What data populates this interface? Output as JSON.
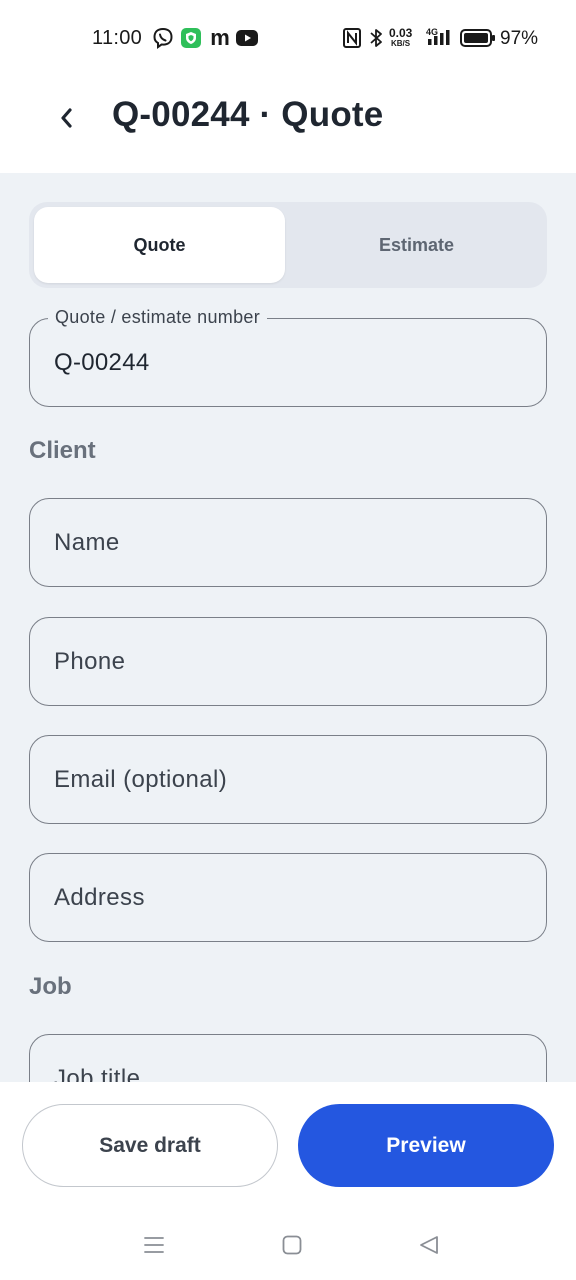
{
  "status_bar": {
    "time": "11:00",
    "net_speed_value": "0.03",
    "net_speed_unit": "KB/S",
    "network_type": "4G",
    "battery": "97%",
    "icons": [
      "viber-icon",
      "shield-app-icon",
      "m-app-icon",
      "youtube-icon",
      "nfc-icon",
      "bluetooth-icon",
      "signal-icon",
      "battery-icon"
    ]
  },
  "header": {
    "back_icon": "chevron-left-icon",
    "title": "Q-00244 · Quote"
  },
  "segmented": {
    "tabs": [
      {
        "label": "Quote",
        "selected": true
      },
      {
        "label": "Estimate",
        "selected": false
      }
    ]
  },
  "quote_number": {
    "label": "Quote / estimate number",
    "value": "Q-00244"
  },
  "client": {
    "section_label": "Client",
    "fields": [
      {
        "placeholder": "Name"
      },
      {
        "placeholder": "Phone"
      },
      {
        "placeholder": "Email (optional)"
      },
      {
        "placeholder": "Address"
      }
    ]
  },
  "job": {
    "section_label": "Job",
    "fields": [
      {
        "placeholder": "Job title"
      }
    ]
  },
  "actions": {
    "save_draft": "Save draft",
    "preview": "Preview"
  },
  "colors": {
    "primary": "#2457e0",
    "content_background": "#eef2f6",
    "section_label": "#69717c"
  },
  "nav_bar": {
    "icons": [
      "menu-icon",
      "home-square-icon",
      "back-triangle-icon"
    ]
  }
}
